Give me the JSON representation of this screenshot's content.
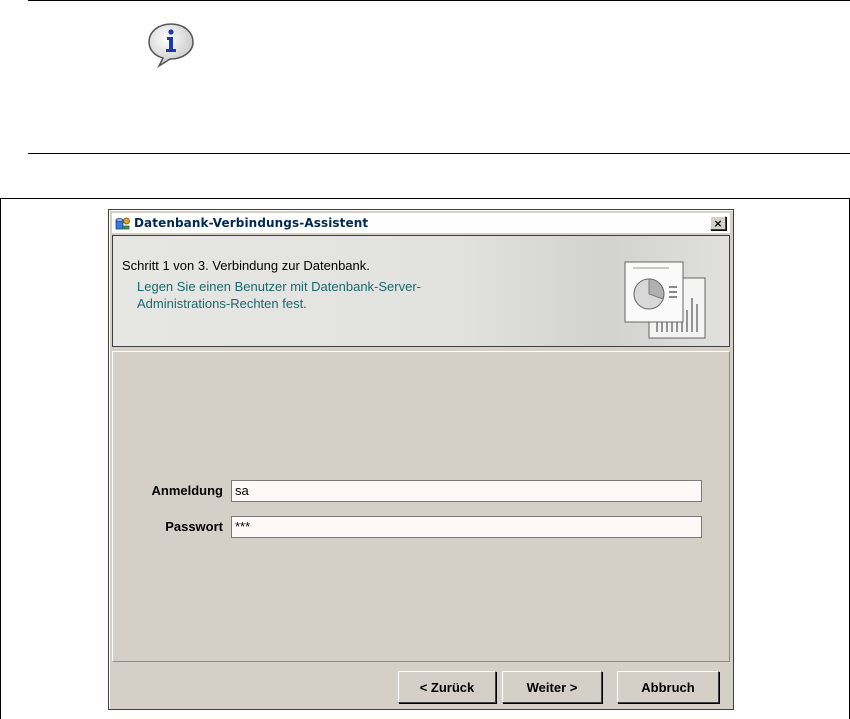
{
  "dialog": {
    "title": "Datenbank-Verbindungs-Assistent",
    "close_label": "×",
    "header": {
      "step": "Schritt 1 von 3. Verbindung zur Datenbank.",
      "description": "Legen Sie einen Benutzer mit Datenbank-Server-Administrations-Rechten fest."
    },
    "fields": [
      {
        "label": "Anmeldung",
        "value": "sa"
      },
      {
        "label": "Passwort",
        "value": "***"
      }
    ],
    "buttons": {
      "back": "< Zurück",
      "next": "Weiter >",
      "cancel": "Abbruch"
    }
  },
  "icons": {
    "info": "info-bubble-icon",
    "app": "database-wizard-icon",
    "header": "chart-graphic-icon"
  },
  "colors": {
    "header_desc": "#1a6a6a",
    "title_text": "#002a55",
    "dialog_bg": "#d4d0c8"
  }
}
